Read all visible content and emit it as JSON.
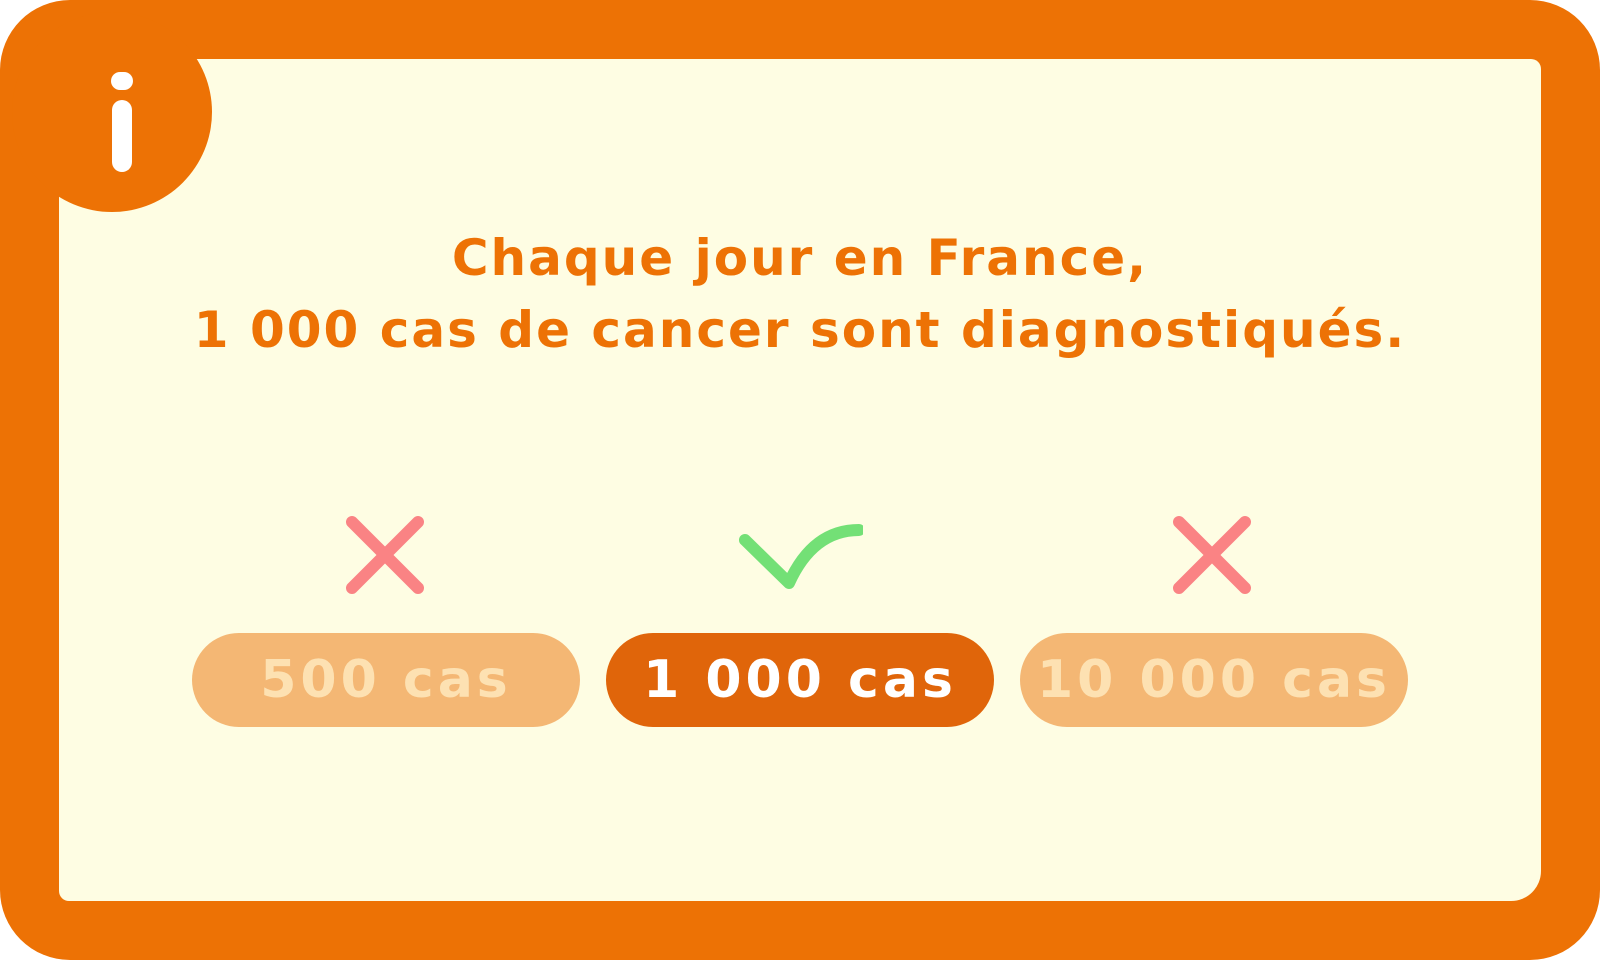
{
  "info": {
    "icon": "info-icon",
    "color": "#ed7205"
  },
  "title": {
    "line1": "Chaque jour en France,",
    "line2": "1 000 cas de cancer sont diagnostiqués."
  },
  "options": [
    {
      "label": "500 cas",
      "correct": false,
      "icon": "cross-icon",
      "color": "#fa8384"
    },
    {
      "label": "1 000 cas",
      "correct": true,
      "icon": "check-icon",
      "color": "#73e076"
    },
    {
      "label": "10 000 cas",
      "correct": false,
      "icon": "cross-icon",
      "color": "#fa8384"
    }
  ],
  "colors": {
    "frame": "#ed7205",
    "background": "#fefde3",
    "pill_active": "#e0650a",
    "pill_inactive": "#f4b774",
    "pill_inactive_text": "#fde1b2"
  }
}
